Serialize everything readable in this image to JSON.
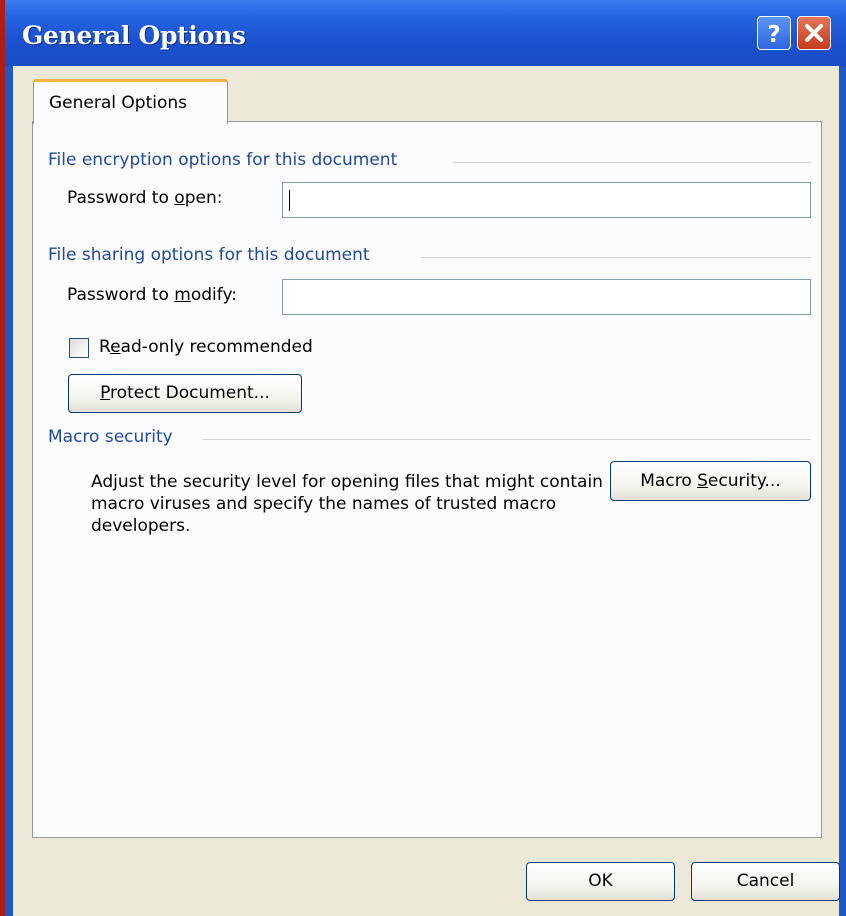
{
  "dialog": {
    "title": "General Options",
    "help_symbol": "?",
    "tab_label": "General Options"
  },
  "encryption": {
    "group_label": "File encryption options for this document",
    "password_open_label_pre": "Password to ",
    "password_open_label_accel": "o",
    "password_open_label_post": "pen:",
    "password_open_value": ""
  },
  "sharing": {
    "group_label": "File sharing options for this document",
    "password_modify_label_pre": "Password to ",
    "password_modify_label_accel": "m",
    "password_modify_label_post": "odify:",
    "password_modify_value": "",
    "readonly_label_pre": "R",
    "readonly_label_accel": "e",
    "readonly_label_post": "ad-only recommended",
    "readonly_checked": false,
    "protect_button_accel": "P",
    "protect_button_rest": "rotect Document..."
  },
  "macro": {
    "group_label": "Macro security",
    "description": "Adjust the security level for opening files that might contain macro viruses and specify the names of trusted macro developers.",
    "button_pre": "Macro ",
    "button_accel": "S",
    "button_post": "ecurity..."
  },
  "footer": {
    "ok_label": "OK",
    "cancel_label": "Cancel"
  },
  "colors": {
    "titlebar": "#2564e0",
    "group_label": "#1e4a9b",
    "tab_highlight": "#f0b44a",
    "dialog_face": "#ece9d8"
  }
}
